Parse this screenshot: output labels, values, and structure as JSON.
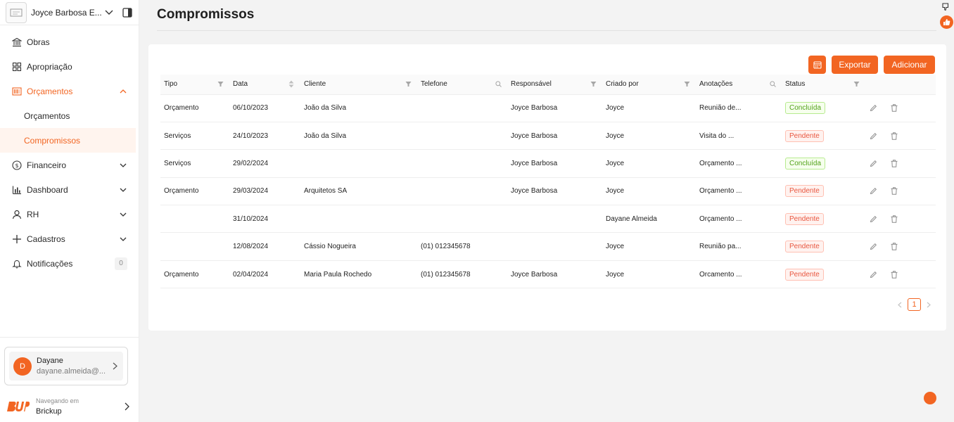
{
  "org": {
    "name": "Joyce Barbosa E..."
  },
  "nav": [
    {
      "label": "Obras",
      "icon": "bank-icon"
    },
    {
      "label": "Apropriação",
      "icon": "grid-icon"
    },
    {
      "label": "Orçamentos",
      "icon": "barcode-icon"
    },
    {
      "label": "Financeiro",
      "icon": "dollar-icon"
    },
    {
      "label": "Dashboard",
      "icon": "bar-chart-icon"
    },
    {
      "label": "RH",
      "icon": "user-icon"
    },
    {
      "label": "Cadastros",
      "icon": "plus-icon"
    },
    {
      "label": "Notificações",
      "icon": "bell-icon",
      "count": "0"
    }
  ],
  "subnav": [
    {
      "label": "Orçamentos"
    },
    {
      "label": "Compromissos"
    }
  ],
  "user": {
    "initial": "D",
    "name": "Dayane",
    "email": "dayane.almeida@..."
  },
  "brand": {
    "sub": "Navegando em",
    "name": "Brickup"
  },
  "page": {
    "title": "Compromissos"
  },
  "toolbar": {
    "export_label": "Exportar",
    "add_label": "Adicionar"
  },
  "table": {
    "headers": [
      "Tipo",
      "Data",
      "Cliente",
      "Telefone",
      "Responsável",
      "Criado por",
      "Anotações",
      "Status"
    ],
    "rows": [
      [
        "Orçamento",
        "06/10/2023",
        "João da Silva",
        "",
        "Joyce Barbosa",
        "Joyce",
        "Reunião de...",
        "Concluída"
      ],
      [
        "Serviços",
        "24/10/2023",
        "João da Silva",
        "",
        "Joyce Barbosa",
        "Joyce",
        "Visita do ...",
        "Pendente"
      ],
      [
        "Serviços",
        "29/02/2024",
        "",
        "",
        "Joyce Barbosa",
        "Joyce",
        "Orçamento ...",
        "Concluída"
      ],
      [
        "Orçamento",
        "29/03/2024",
        "Arquitetos SA",
        "",
        "Joyce Barbosa",
        "Joyce",
        "Orçamento ...",
        "Pendente"
      ],
      [
        "",
        "31/10/2024",
        "",
        "",
        "",
        "Dayane Almeida",
        "Orçamento ...",
        "Pendente"
      ],
      [
        "",
        "12/08/2024",
        "Cássio Nogueira",
        "(01) 012345678",
        "",
        "Joyce",
        "Reunião pa...",
        "Pendente"
      ],
      [
        "Orçamento",
        "02/04/2024",
        "Maria Paula Rochedo",
        "(01) 012345678",
        "Joyce Barbosa",
        "Joyce",
        "Orcamento ...",
        "Pendente"
      ]
    ]
  },
  "pagination": {
    "current": "1"
  },
  "colors": {
    "accent": "#f26522",
    "done": "#52a11a",
    "pending": "#e8563f"
  }
}
